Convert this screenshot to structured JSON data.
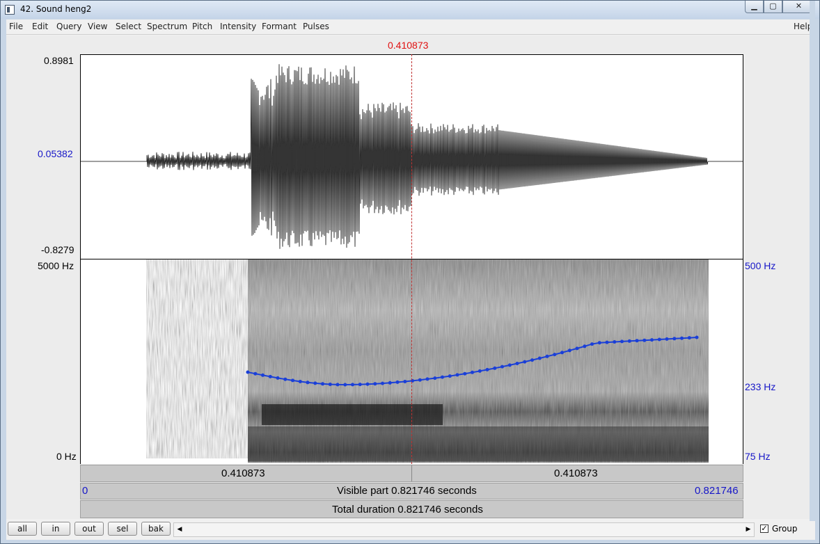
{
  "window": {
    "title": "42. Sound heng2"
  },
  "menu": {
    "items": [
      "File",
      "Edit",
      "Query",
      "View",
      "Select",
      "Spectrum",
      "Pitch",
      "Intensity",
      "Formant",
      "Pulses"
    ],
    "help": "Help"
  },
  "cursor": {
    "time_label": "0.410873"
  },
  "waveform": {
    "y_max": "0.8981",
    "y_mid": "0.05382",
    "y_min": "-0.8279"
  },
  "spectrogram": {
    "freq_max": "5000 Hz",
    "freq_min": "0 Hz",
    "pitch_max": "500 Hz",
    "pitch_mid": "233 Hz",
    "pitch_min": "75 Hz"
  },
  "bars": {
    "left_sel": "0.410873",
    "right_sel": "0.410873",
    "visible_start": "0",
    "visible_text": "Visible part 0.821746 seconds",
    "visible_end": "0.821746",
    "total_text": "Total duration 0.821746 seconds"
  },
  "bottom": {
    "buttons": [
      "all",
      "in",
      "out",
      "sel",
      "bak"
    ],
    "group_label": "Group",
    "group_checked": "✓"
  },
  "colors": {
    "cursor": "#e01010",
    "pitch_curve": "#1a3fd8",
    "axis_blue": "#1616c8"
  }
}
